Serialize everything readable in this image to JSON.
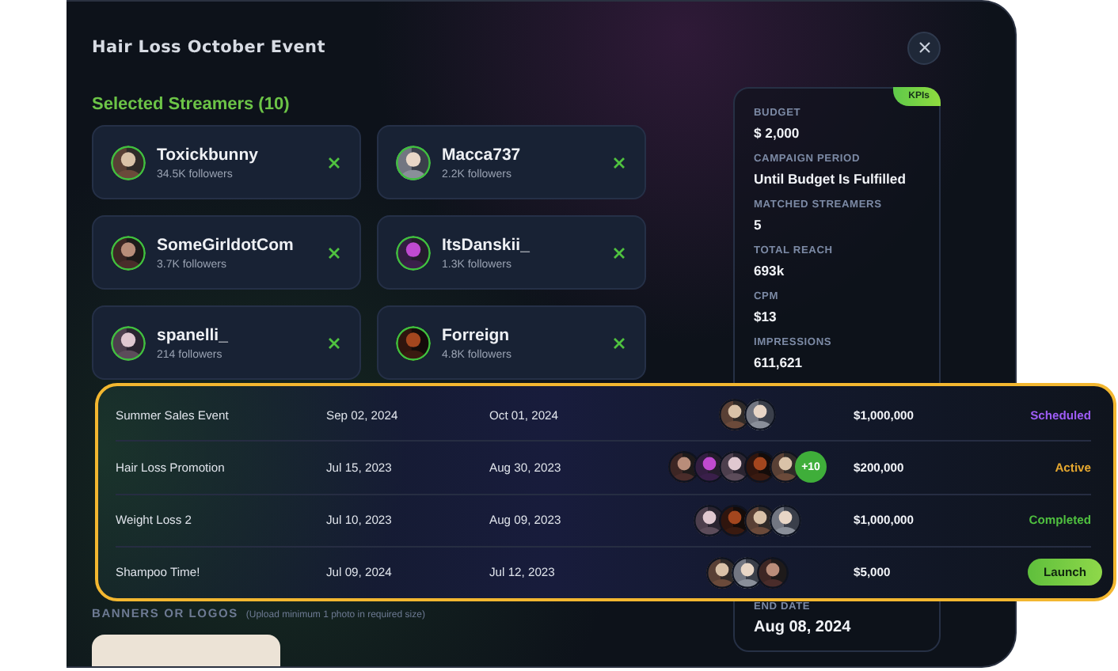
{
  "modal": {
    "title": "Hair Loss October Event"
  },
  "selected_streamers": {
    "heading": "Selected Streamers (10)",
    "items": [
      {
        "name": "Toxickbunny",
        "followers": "34.5K followers"
      },
      {
        "name": "Macca737",
        "followers": "2.2K followers"
      },
      {
        "name": "SomeGirldotCom",
        "followers": "3.7K followers"
      },
      {
        "name": "ItsDanskii_",
        "followers": "1.3K followers"
      },
      {
        "name": "spanelli_",
        "followers": "214 followers"
      },
      {
        "name": "Forreign",
        "followers": "4.8K followers"
      }
    ]
  },
  "banners": {
    "label": "BANNERS OR LOGOS",
    "hint": "(Upload minimum 1 photo in required size)"
  },
  "kpis": {
    "badge": "KPIs",
    "items": [
      {
        "label": "BUDGET",
        "value": "$ 2,000"
      },
      {
        "label": "CAMPAIGN PERIOD",
        "value": "Until Budget Is Fulfilled"
      },
      {
        "label": "MATCHED STREAMERS",
        "value": "5"
      },
      {
        "label": "TOTAL REACH",
        "value": "693k"
      },
      {
        "label": "CPM",
        "value": "$13"
      },
      {
        "label": "IMPRESSIONS",
        "value": "611,621"
      }
    ],
    "end_date": {
      "label": "END DATE",
      "value": "Aug 08, 2024"
    }
  },
  "campaigns": {
    "rows": [
      {
        "name": "Summer Sales Event",
        "start": "Sep 02, 2024",
        "end": "Oct 01, 2024",
        "amount": "$1,000,000",
        "status": {
          "kind": "scheduled",
          "label": "Scheduled"
        }
      },
      {
        "name": "Hair Loss Promotion",
        "start": "Jul 15, 2023",
        "end": "Aug 30, 2023",
        "more": "+10",
        "amount": "$200,000",
        "status": {
          "kind": "active",
          "label": "Active"
        }
      },
      {
        "name": "Weight Loss 2",
        "start": "Jul 10, 2023",
        "end": "Aug 09, 2023",
        "amount": "$1,000,000",
        "status": {
          "kind": "completed",
          "label": "Completed"
        }
      },
      {
        "name": "Shampoo Time!",
        "start": "Jul 09, 2024",
        "end": "Jul 12, 2023",
        "amount": "$5,000",
        "status": {
          "kind": "launch",
          "label": "Launch"
        }
      }
    ]
  }
}
